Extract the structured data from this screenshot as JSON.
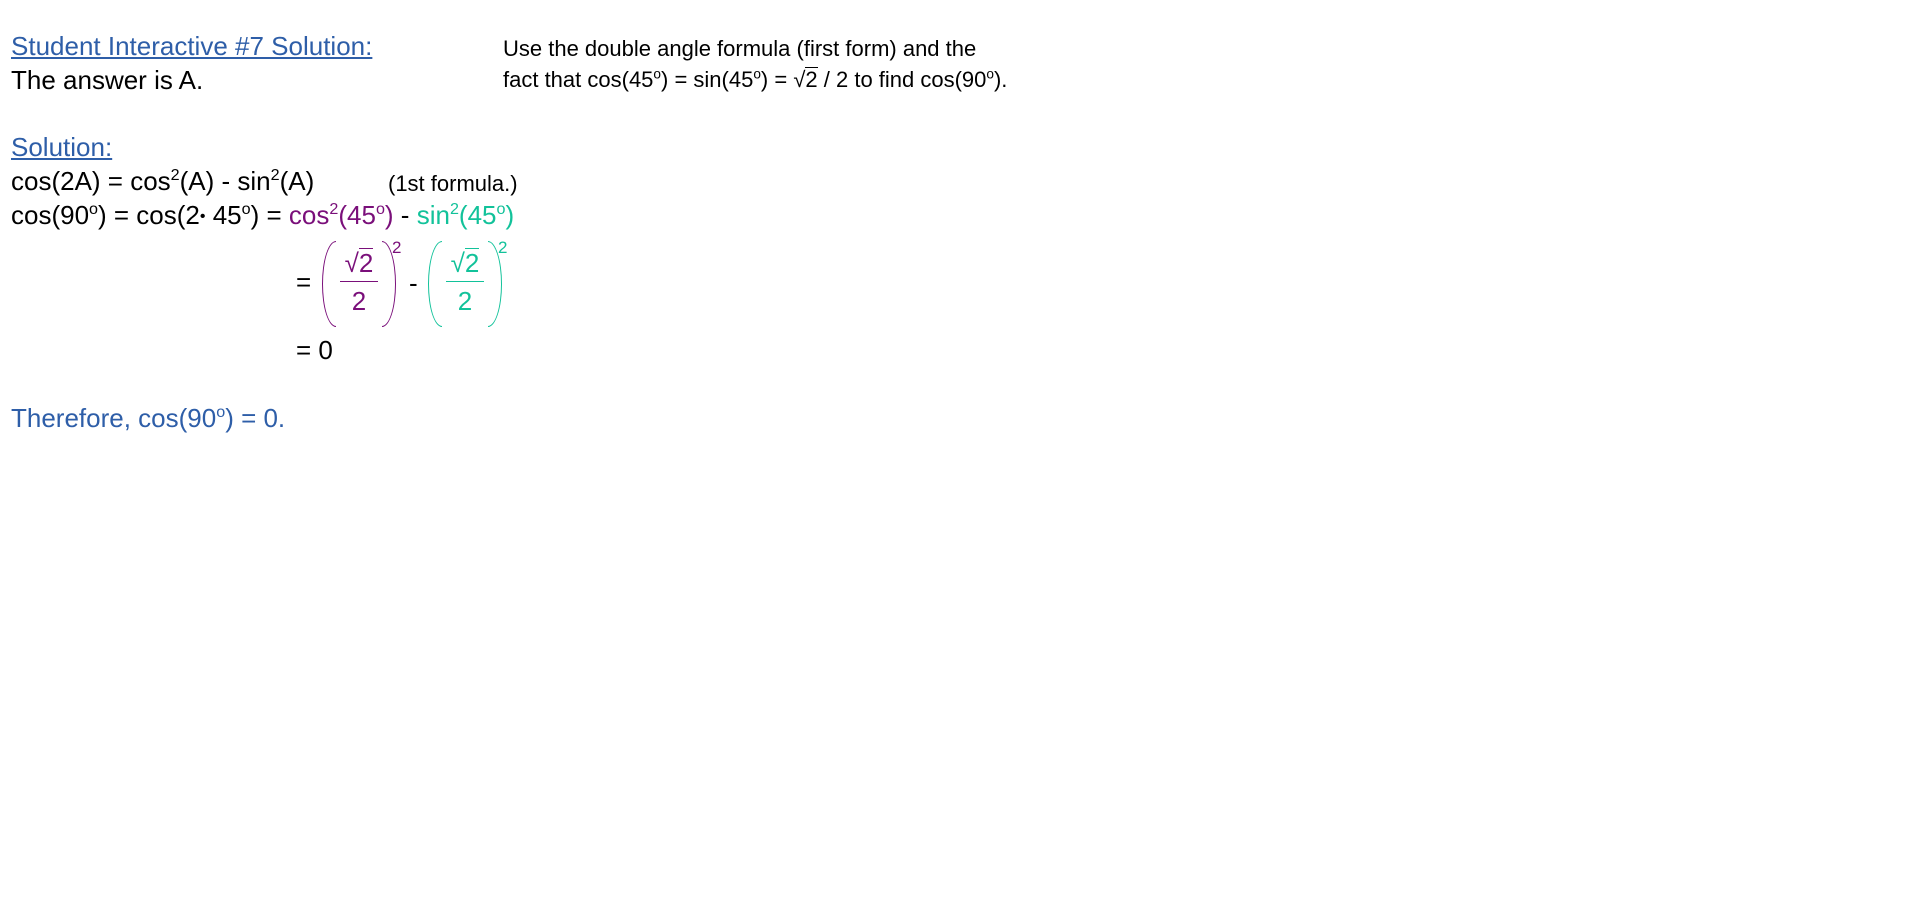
{
  "header": {
    "title": "Student Interactive #7 Solution:",
    "answer": "The answer is A."
  },
  "instructions": {
    "line1": "Use the double angle formula (first form) and the",
    "line2_a": "fact that cos(45",
    "deg": "o",
    "line2_b": ") = sin(45",
    "line2_c": ") = ",
    "sqrt_sym": "√",
    "sqrt_val": "2",
    "line2_d": " / 2 to find cos(90",
    "line2_e": ")."
  },
  "solution": {
    "heading": "Solution:",
    "formula_a": "cos(2A) = cos",
    "sq": "2",
    "formula_b": "(A) - sin",
    "formula_c": "(A)",
    "formula_note": "(1st formula.)",
    "step1_a": "cos(90",
    "step1_b": ") = cos(2",
    "dot": "•",
    "step1_c": " 45",
    "step1_d": ") = ",
    "step1_cos": "cos",
    "step1_cos_arg": "(45",
    "step1_close": ")",
    "step1_minus": " - ",
    "step1_sin": "sin",
    "equals": "=",
    "frac_num_sym": "√",
    "frac_num_val": "2",
    "frac_den": "2",
    "exp": "2",
    "minus": "-",
    "result": "= 0",
    "conclusion_a": "Therefore, cos(90",
    "conclusion_b": ") = 0."
  },
  "colors": {
    "link": "#2e5ea8",
    "cos_term": "#7a0f7a",
    "sin_term": "#12c29a"
  }
}
